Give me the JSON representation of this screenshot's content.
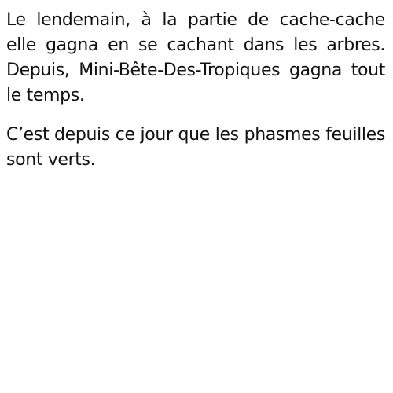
{
  "document": {
    "paragraphs": [
      "Le lendemain, à la partie de cache-cache elle gagna en se cachant dans les arbres. Depuis, Mini-Bête-Des-Tropiques gagna tout le temps.",
      "C’est depuis ce jour que les phasmes feuilles sont verts."
    ]
  }
}
